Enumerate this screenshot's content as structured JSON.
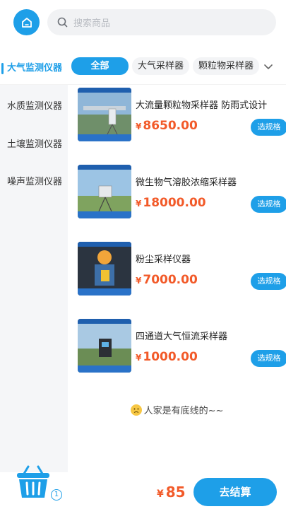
{
  "search": {
    "placeholder": "搜索商品"
  },
  "category_bar": {
    "active_category": "大气监测仪器",
    "sub_tabs": [
      "全部",
      "大气采样器",
      "颗粒物采样器"
    ]
  },
  "sidebar": {
    "items": [
      "水质监测仪器",
      "土壤监测仪器",
      "噪声监测仪器"
    ]
  },
  "products": [
    {
      "name": "大流量颗粒物采样器 防雨式设计",
      "currency": "¥",
      "price": "8650.00",
      "button": "选规格"
    },
    {
      "name": "微生物气溶胶浓缩采样器",
      "currency": "¥",
      "price": "18000.00",
      "button": "选规格"
    },
    {
      "name": "粉尘采样仪器",
      "currency": "¥",
      "price": "7000.00",
      "button": "选规格"
    },
    {
      "name": "四通道大气恒流采样器",
      "currency": "¥",
      "price": "1000.00",
      "button": "选规格"
    }
  ],
  "end_note": "人家是有底线的~~",
  "cart": {
    "count": "1",
    "currency": "¥",
    "total": "85",
    "checkout_label": "去结算"
  },
  "colors": {
    "accent": "#1e9fe8",
    "price": "#f25a29"
  }
}
